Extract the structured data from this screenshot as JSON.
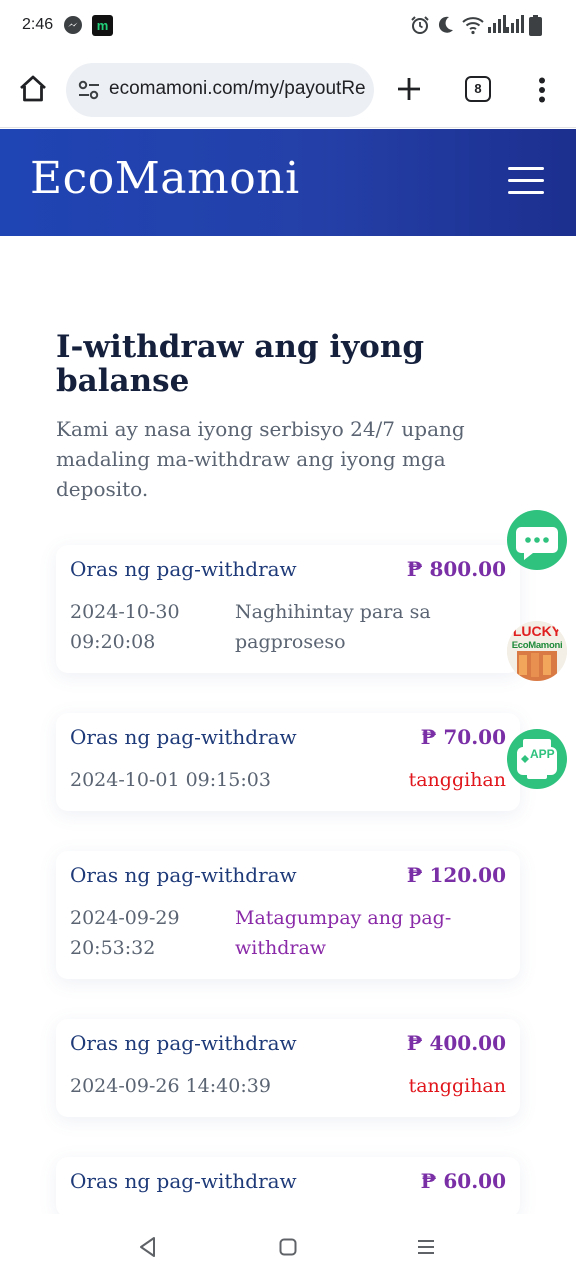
{
  "status_bar": {
    "time": "2:46",
    "icons": [
      "messenger-icon",
      "m-app-icon",
      "alarm-icon",
      "moon-icon",
      "wifi-icon",
      "signal-icon",
      "signal-icon",
      "battery-icon"
    ]
  },
  "browser": {
    "url": "ecomamoni.com/my/payoutRec",
    "tab_count": "8",
    "icons": [
      "home-icon",
      "tune-icon",
      "plus-icon",
      "more-vert-icon"
    ]
  },
  "header": {
    "logo": "EcoMamoni",
    "menu_icon": "hamburger-icon",
    "gradient_colors": [
      "#1f44b4",
      "#1c2f8f"
    ]
  },
  "page": {
    "title": "I-withdraw ang iyong balanse",
    "description": "Kami ay nasa iyong serbisyo 24/7 upang madaling ma-withdraw ang iyong mga deposito."
  },
  "records": [
    {
      "label": "Oras ng pag-withdraw",
      "amount": "₱ 800.00",
      "datetime": "2024-10-30 09:20:08",
      "status": "Naghihintay para sa pagproseso",
      "status_type": "pending"
    },
    {
      "label": "Oras ng pag-withdraw",
      "amount": "₱ 70.00",
      "datetime": "2024-10-01 09:15:03",
      "status": "tanggihan",
      "status_type": "rejected"
    },
    {
      "label": "Oras ng pag-withdraw",
      "amount": "₱ 120.00",
      "datetime": "2024-09-29 20:53:32",
      "status": "Matagumpay ang pag-withdraw",
      "status_type": "success"
    },
    {
      "label": "Oras ng pag-withdraw",
      "amount": "₱ 400.00",
      "datetime": "2024-09-26 14:40:39",
      "status": "tanggihan",
      "status_type": "rejected"
    },
    {
      "label": "Oras ng pag-withdraw",
      "amount": "₱ 60.00"
    }
  ],
  "floating": {
    "lucky_label": "LUCKY",
    "lucky_brand": "EcoMamoni",
    "app_label": "APP",
    "icons": [
      "chat-icon",
      "app-download-icon"
    ]
  },
  "colors": {
    "accent": "#7a2fa6",
    "rejected": "#e0161c",
    "label": "#1e3a78",
    "float_green": "#2ec27e"
  },
  "nav": {
    "icons": [
      "back-icon",
      "home-square-icon",
      "recents-icon"
    ]
  }
}
